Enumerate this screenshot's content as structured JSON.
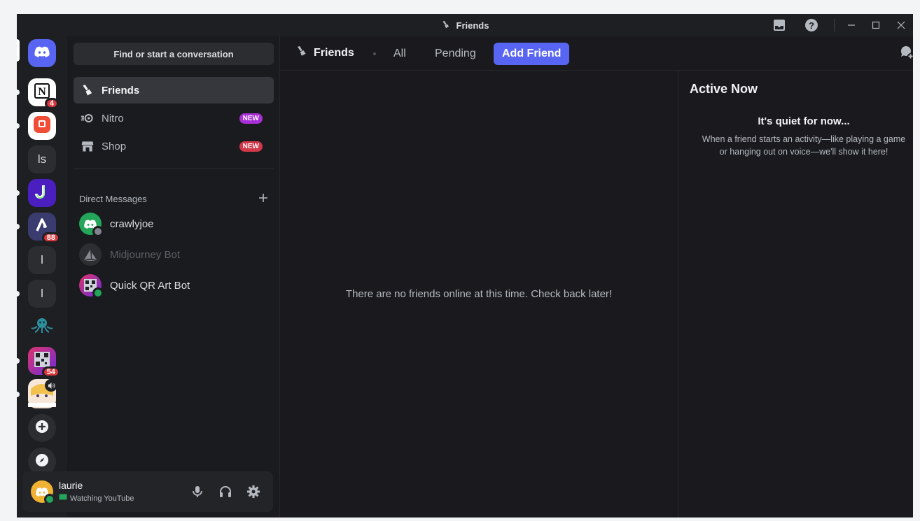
{
  "window": {
    "title": "Friends"
  },
  "colors": {
    "accent": "#5865f2",
    "online": "#23a55a",
    "danger": "#da373c",
    "new_purple": "#a82ed6"
  },
  "servers": [
    {
      "name": "home",
      "icon": "discord-logo-icon"
    },
    {
      "name": "notion",
      "icon": "notion-icon",
      "badge": "4"
    },
    {
      "name": "red-app",
      "icon": "red-square-icon"
    },
    {
      "name": "ls",
      "label": "ls"
    },
    {
      "name": "j-server",
      "icon": "j-logo-icon"
    },
    {
      "name": "a-server",
      "icon": "a-logo-icon",
      "badge": "88"
    },
    {
      "name": "l-server-1",
      "label": "l"
    },
    {
      "name": "l-server-2",
      "label": "l"
    },
    {
      "name": "octopus-server",
      "icon": "octopus-icon"
    },
    {
      "name": "qr-server",
      "icon": "qr-code-icon",
      "badge": "54"
    },
    {
      "name": "anime-server",
      "icon": "anime-avatar-icon",
      "speaker": true
    },
    {
      "name": "add-server",
      "icon": "plus-icon"
    },
    {
      "name": "discover",
      "icon": "compass-icon"
    }
  ],
  "sidebar": {
    "search_label": "Find or start a conversation",
    "nav": [
      {
        "label": "Friends",
        "icon": "friends-wave-icon",
        "active": true
      },
      {
        "label": "Nitro",
        "icon": "nitro-icon",
        "badge": "NEW"
      },
      {
        "label": "Shop",
        "icon": "shop-icon",
        "badge": "NEW"
      }
    ],
    "dm_header": "Direct Messages",
    "dms": [
      {
        "name": "crawlyjoe",
        "status": "offline"
      },
      {
        "name": "Midjourney Bot",
        "status": "none"
      },
      {
        "name": "Quick QR Art Bot",
        "status": "online"
      }
    ]
  },
  "user": {
    "name": "laurie",
    "status_text": "Watching YouTube"
  },
  "main": {
    "title": "Friends",
    "tabs": [
      "All",
      "Pending",
      "Add Friend"
    ],
    "empty_message": "There are no friends online at this time. Check back later!",
    "active_now": {
      "title": "Active Now",
      "quiet_title": "It's quiet for now...",
      "quiet_desc": "When a friend starts an activity—like playing a game or hanging out on voice—we'll show it here!"
    }
  }
}
